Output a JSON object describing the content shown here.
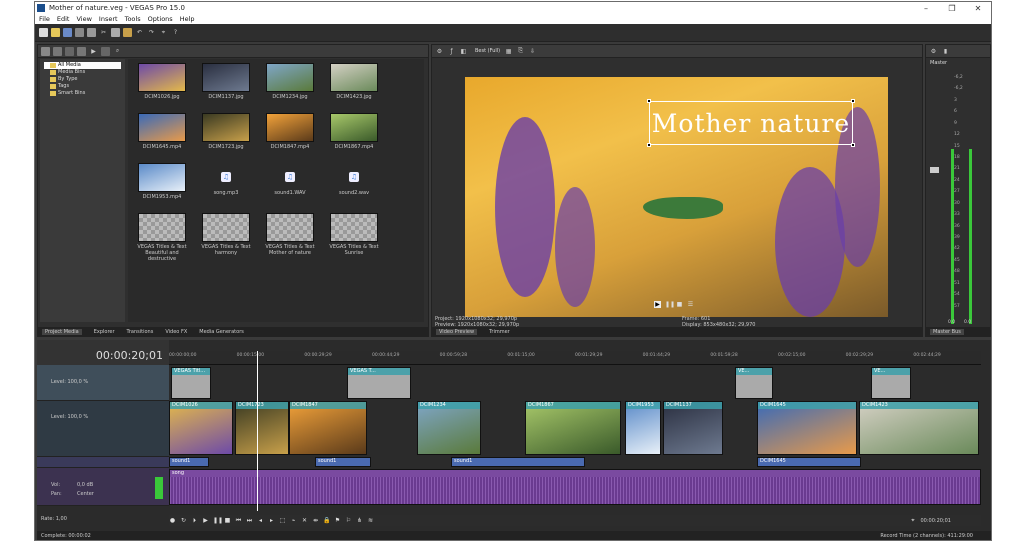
{
  "window": {
    "title": "Mother of nature.veg - VEGAS Pro 15.0",
    "min": "–",
    "max": "❐",
    "close": "✕"
  },
  "menu": [
    "File",
    "Edit",
    "View",
    "Insert",
    "Tools",
    "Options",
    "Help"
  ],
  "explorer": {
    "tree": [
      "All Media",
      "Media Bins",
      "By Type",
      "Tags",
      "Smart Bins"
    ],
    "items": [
      {
        "name": "DCIM1026.jpg",
        "kind": "img",
        "c1": "#6d4aa8",
        "c2": "#e4b94a"
      },
      {
        "name": "DCIM1137.jpg",
        "kind": "img",
        "c1": "#2a2f40",
        "c2": "#6e7a90"
      },
      {
        "name": "DCIM1234.jpg",
        "kind": "img",
        "c1": "#7fa6c8",
        "c2": "#5a7a3a"
      },
      {
        "name": "DCIM1423.jpg",
        "kind": "img",
        "c1": "#d4d0c4",
        "c2": "#6a8a5a"
      },
      {
        "name": "DCIM1645.mp4",
        "kind": "img",
        "c1": "#3a6ab8",
        "c2": "#e89a4a"
      },
      {
        "name": "DCIM1723.jpg",
        "kind": "img",
        "c1": "#3a3a22",
        "c2": "#c8a04a"
      },
      {
        "name": "DCIM1847.mp4",
        "kind": "img",
        "c1": "#f2a23a",
        "c2": "#5a3a1a"
      },
      {
        "name": "DCIM1867.mp4",
        "kind": "img",
        "c1": "#a8c86a",
        "c2": "#3a5a2a"
      },
      {
        "name": "DCIM1953.mp4",
        "kind": "img",
        "c1": "#5a8ac8",
        "c2": "#e8f0f8"
      },
      {
        "name": "song.mp3",
        "kind": "aud"
      },
      {
        "name": "sound1.WAV",
        "kind": "aud"
      },
      {
        "name": "sound2.wav",
        "kind": "aud"
      },
      {
        "name": "VEGAS Titles & Text Beautiful and destructive",
        "kind": "title"
      },
      {
        "name": "VEGAS Titles & Text harmony",
        "kind": "title"
      },
      {
        "name": "VEGAS Titles & Text Mother of nature",
        "kind": "title"
      },
      {
        "name": "VEGAS Titles & Text Sunrise",
        "kind": "title"
      }
    ],
    "tabs": [
      "Project Media",
      "Explorer",
      "Transitions",
      "Video FX",
      "Media Generators"
    ]
  },
  "preview": {
    "quality": "Best (Full)",
    "caption": "Mother nature",
    "project": "Project:  1920x1080x32; 29,970p",
    "preview_info": "Preview:  1920x1080x32; 29,970p",
    "frame": "Frame:   601",
    "display": "Display:   853x480x32; 29,970",
    "tabs": [
      "Video Preview",
      "Trimmer"
    ]
  },
  "master": {
    "label": "Master",
    "scale": [
      "-6,2",
      "-6,2",
      "3",
      "6",
      "9",
      "12",
      "15",
      "18",
      "21",
      "24",
      "27",
      "30",
      "33",
      "36",
      "39",
      "42",
      "45",
      "48",
      "51",
      "54",
      "57"
    ],
    "bottom_left": "0.0",
    "bottom_right": "0.0",
    "tab": "Master Bus"
  },
  "timeline": {
    "timecode": "00:00:20;01",
    "ruler": [
      "00:00:00;00",
      "00:00:15;00",
      "00:00:29;29",
      "00:00:44;29",
      "00:00:59;28",
      "00:01:15;00",
      "00:01:29;29",
      "00:01:44;29",
      "00:01:59;28",
      "00:02:15;00",
      "00:02:29;29",
      "00:02:44;29"
    ],
    "track1_level": "Level: 100,0 %",
    "track2_level": "Level: 100,0 %",
    "audio_vol": "Vol:",
    "audio_vol_val": "0,0 dB",
    "audio_pan": "Pan:",
    "audio_pan_val": "Center",
    "rate": "Rate: 1,00",
    "title_clips": [
      {
        "label": "VEGAS Titl..."
      },
      {
        "label": "VEGAS T..."
      },
      {
        "label": "VE..."
      },
      {
        "label": "VE..."
      }
    ],
    "video_clips": [
      {
        "label": "DCIM1026",
        "c1": "#e4b94a",
        "c2": "#6d4aa8"
      },
      {
        "label": "DCIM1723",
        "c1": "#3a3a22",
        "c2": "#c8a04a"
      },
      {
        "label": "DCIM1847",
        "c1": "#f2a23a",
        "c2": "#5a3a1a"
      },
      {
        "label": "DCIM1234",
        "c1": "#7fa6c8",
        "c2": "#5a7a3a"
      },
      {
        "label": "DCIM1867",
        "c1": "#a8c86a",
        "c2": "#3a5a2a"
      },
      {
        "label": "DCIM1953",
        "c1": "#5a8ac8",
        "c2": "#e8f0f8"
      },
      {
        "label": "DCIM1137",
        "c1": "#2a2f40",
        "c2": "#6e7a90"
      },
      {
        "label": "DCIM1645",
        "c1": "#3a6ab8",
        "c2": "#e89a4a"
      },
      {
        "label": "DCIM1423",
        "c1": "#d4d0c4",
        "c2": "#6a8a5a"
      }
    ],
    "sound_clips": [
      "sound1",
      "sound1",
      "sound1",
      "DCIM1645"
    ],
    "song": "song",
    "record_timecode": "00:00:20;01",
    "record_time": "Record Time (2 channels): 411:29:00",
    "complete": "Complete: 00:00:02"
  }
}
